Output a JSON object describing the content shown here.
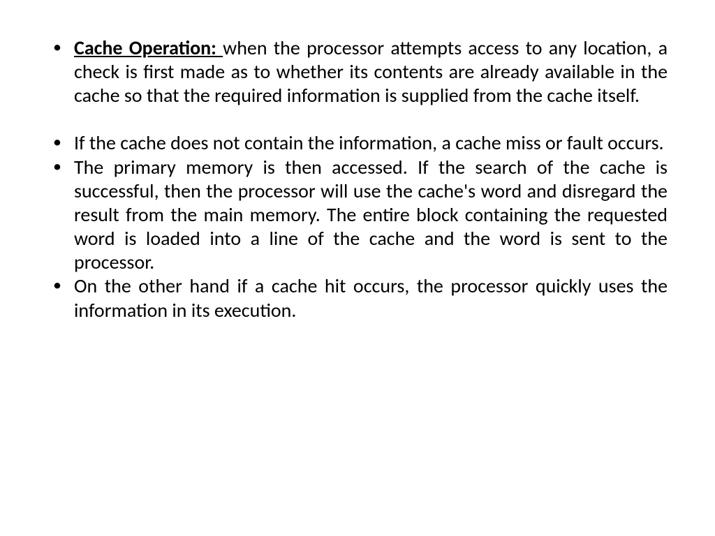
{
  "bullets": [
    {
      "lead": "Cache Operation: ",
      "rest": "when the processor attempts access to any location, a check is first made as to whether its contents are already available in the cache so that the required information is supplied from the cache itself."
    },
    {
      "lead": "",
      "rest": "If the cache does not contain the information, a cache miss or fault occurs."
    },
    {
      "lead": "",
      "rest": "The primary memory is then accessed. If the search of the cache is successful, then the processor will use the cache's word and disregard the result from the main memory. The entire block containing the requested word is loaded into a line of the cache and the word is sent to the processor."
    },
    {
      "lead": "",
      "rest": "On the other hand if a cache hit occurs, the processor quickly uses the information in its execution."
    }
  ]
}
